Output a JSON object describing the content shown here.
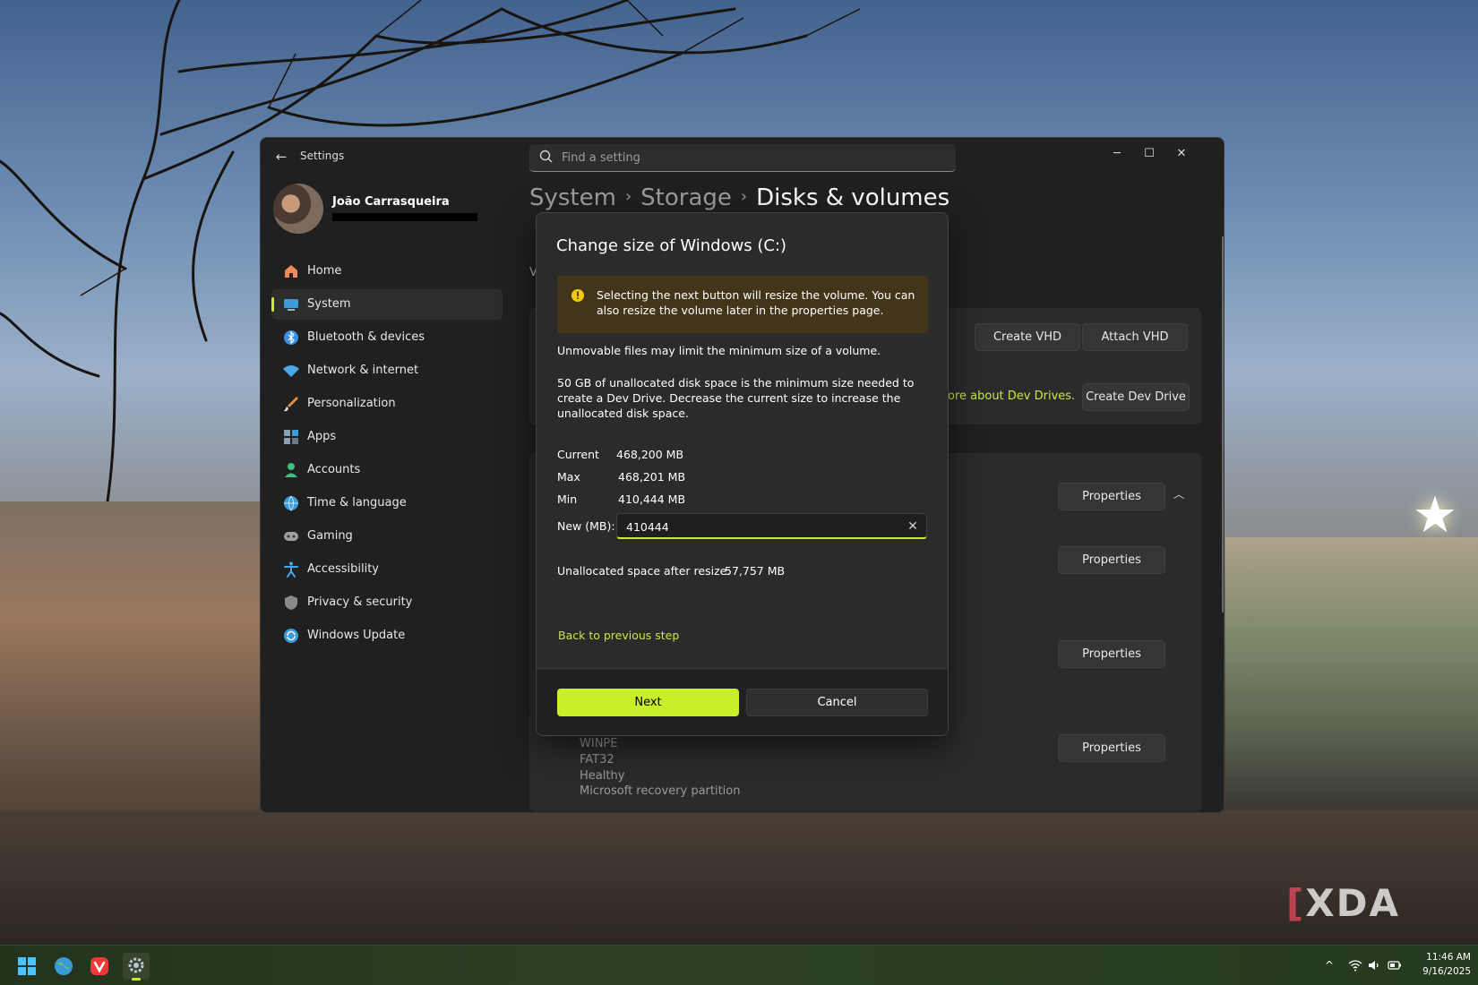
{
  "window": {
    "title": "Settings",
    "search_placeholder": "Find a setting",
    "controls": {
      "minimize": "─",
      "maximize": "☐",
      "close": "✕"
    }
  },
  "profile": {
    "name": "João Carrasqueira"
  },
  "sidebar": {
    "items": [
      {
        "label": "Home",
        "icon": "home-icon",
        "color": "#f08a5d"
      },
      {
        "label": "System",
        "icon": "system-icon",
        "color": "#3a9bd8",
        "active": true
      },
      {
        "label": "Bluetooth & devices",
        "icon": "bluetooth-icon",
        "color": "#3a8fe0"
      },
      {
        "label": "Network & internet",
        "icon": "wifi-icon",
        "color": "#4aa8e8"
      },
      {
        "label": "Personalization",
        "icon": "brush-icon",
        "color": "#e0903a"
      },
      {
        "label": "Apps",
        "icon": "apps-icon",
        "color": "#8aa0b8"
      },
      {
        "label": "Accounts",
        "icon": "accounts-icon",
        "color": "#3cc07a"
      },
      {
        "label": "Time & language",
        "icon": "globe-icon",
        "color": "#3a9bd8"
      },
      {
        "label": "Gaming",
        "icon": "gamepad-icon",
        "color": "#a0a0a0"
      },
      {
        "label": "Accessibility",
        "icon": "accessibility-icon",
        "color": "#4aa8e8"
      },
      {
        "label": "Privacy & security",
        "icon": "shield-icon",
        "color": "#8a8a8a"
      },
      {
        "label": "Windows Update",
        "icon": "update-icon",
        "color": "#3a9bd8"
      }
    ]
  },
  "breadcrumb": {
    "level1": "System",
    "sep": "›",
    "level2": "Storage",
    "current": "Disks & volumes"
  },
  "main": {
    "v_letter": "V",
    "create_vhd": "Create VHD",
    "attach_vhd": "Attach VHD",
    "dev_drive_link": "ore about Dev Drives.",
    "create_dev_drive": "Create Dev Drive",
    "properties": "Properties",
    "volume": {
      "name": "WINPE",
      "fs": "FAT32",
      "status": "Healthy",
      "type": "Microsoft recovery partition"
    }
  },
  "dialog": {
    "title": "Change size of Windows (C:)",
    "warning": "Selecting the next button will resize the volume. You can also resize the volume later in the properties page.",
    "note1": "Unmovable files may limit the minimum size of a volume.",
    "note2": "50 GB of unallocated disk space is the minimum size needed to create a Dev Drive. Decrease the current size to increase the unallocated disk space.",
    "current_label": "Current",
    "current_value": "468,200 MB",
    "max_label": "Max",
    "max_value": "468,201 MB",
    "min_label": "Min",
    "min_value": "410,444 MB",
    "new_label": "New (MB):",
    "new_value": "410444",
    "unallocated_label": "Unallocated space after resize:",
    "unallocated_value": "57,757 MB",
    "back_link": "Back to previous step",
    "next": "Next",
    "cancel": "Cancel"
  },
  "taskbar": {
    "apps": [
      "windows-start-icon",
      "browser-globe-icon",
      "vivaldi-icon",
      "settings-gear-icon"
    ],
    "time": "11:46 AM",
    "date": "9/16/2025"
  },
  "watermark": "XDA",
  "colors": {
    "accent": "#c8f02a",
    "warning_bg": "#433519",
    "link": "#c6e84a"
  }
}
